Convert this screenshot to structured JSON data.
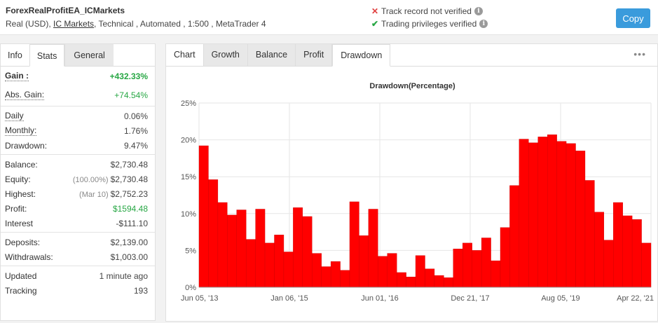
{
  "header": {
    "title": "ForexRealProfitEA_ICMarkets",
    "sub_prefix": "Real (USD), ",
    "broker": "IC Markets",
    "sub_suffix": ", Technical , Automated , 1:500 , MetaTrader 4",
    "verify_track": "Track record not verified",
    "verify_trading": "Trading privileges verified",
    "copy_label": "Copy"
  },
  "left_tabs": [
    "Info",
    "Stats",
    "General"
  ],
  "stats": {
    "gain": {
      "label": "Gain :",
      "value": "+432.33%"
    },
    "abs_gain": {
      "label": "Abs. Gain:",
      "value": "+74.54%"
    },
    "daily": {
      "label": "Daily",
      "value": "0.06%"
    },
    "monthly": {
      "label": "Monthly:",
      "value": "1.76%"
    },
    "drawdown": {
      "label": "Drawdown:",
      "value": "9.47%"
    },
    "balance": {
      "label": "Balance:",
      "value": "$2,730.48"
    },
    "equity": {
      "label": "Equity:",
      "note": "(100.00%)",
      "value": "$2,730.48"
    },
    "highest": {
      "label": "Highest:",
      "note": "(Mar 10)",
      "value": "$2,752.23"
    },
    "profit": {
      "label": "Profit:",
      "value": "$1594.48"
    },
    "interest": {
      "label": "Interest",
      "value": "-$111.10"
    },
    "deposits": {
      "label": "Deposits:",
      "value": "$2,139.00"
    },
    "withdrawals": {
      "label": "Withdrawals:",
      "value": "$1,003.00"
    },
    "updated": {
      "label": "Updated",
      "value": "1 minute ago"
    },
    "tracking": {
      "label": "Tracking",
      "value": "193"
    }
  },
  "right_tabs": [
    "Chart",
    "Growth",
    "Balance",
    "Profit",
    "Drawdown"
  ],
  "more_icon": "ellipsis-icon",
  "colors": {
    "accent": "#3a9bdc",
    "green": "#27a744",
    "red_bar": "#ff0000",
    "x_mark": "#e04040"
  },
  "chart_data": {
    "type": "area",
    "title": "Drawdown(Percentage)",
    "ylabel": "",
    "xlabel": "",
    "y_ticks": [
      "0%",
      "5%",
      "10%",
      "15%",
      "20%",
      "25%"
    ],
    "ylim": [
      0,
      25
    ],
    "x_ticks": [
      "Jun 05, '13",
      "Jan 06, '15",
      "Jun 01, '16",
      "Dec 21, '17",
      "Aug 05, '19",
      "Apr 22, '21"
    ],
    "x": [
      "Jun 05, '13",
      "Jul '13",
      "Sep '13",
      "Nov '13",
      "Jan '14",
      "Mar '14",
      "May '14",
      "Jul '14",
      "Sep '14",
      "Nov '14",
      "Jan 06, '15",
      "Mar '15",
      "May '15",
      "Jul '15",
      "Sep '15",
      "Nov '15",
      "Jan '16",
      "Mar '16",
      "Jun 01, '16",
      "Aug '16",
      "Oct '16",
      "Dec '16",
      "Feb '17",
      "Apr '17",
      "Jun '17",
      "Aug '17",
      "Oct '17",
      "Dec 21, '17",
      "Feb '18",
      "Apr '18",
      "Jun '18",
      "Aug '18",
      "Oct '18",
      "Dec '18",
      "Feb '19",
      "Apr '19",
      "Jun '19",
      "Aug 05, '19",
      "Oct '19",
      "Dec '19",
      "Feb '20",
      "Apr '20",
      "Jun '20",
      "Aug '20",
      "Oct '20",
      "Dec '20",
      "Feb '21",
      "Apr 22, '21"
    ],
    "values": [
      19.2,
      14.6,
      11.5,
      9.8,
      10.5,
      6.5,
      10.6,
      6.0,
      7.1,
      4.8,
      10.8,
      9.6,
      4.6,
      2.8,
      3.5,
      2.3,
      11.6,
      7.0,
      10.6,
      4.2,
      4.6,
      2.0,
      1.4,
      4.3,
      2.5,
      1.6,
      1.3,
      5.2,
      6.0,
      5.0,
      6.7,
      3.6,
      8.1,
      13.8,
      20.1,
      19.6,
      20.4,
      20.7,
      19.8,
      19.5,
      18.5,
      14.5,
      10.2,
      6.4,
      11.5,
      9.7,
      9.2,
      6.0
    ]
  }
}
